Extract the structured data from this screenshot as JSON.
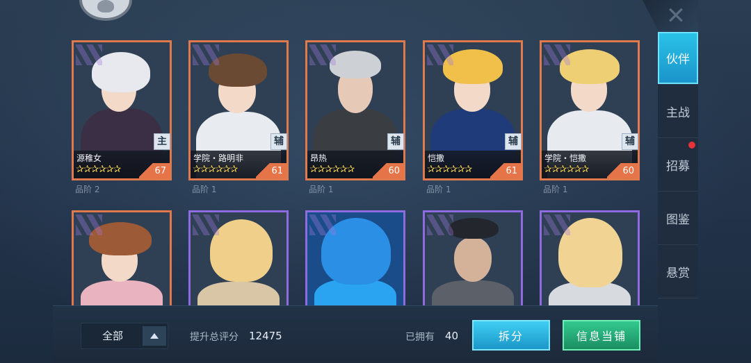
{
  "tabs": [
    {
      "label": "伙伴",
      "active": true,
      "notify": false
    },
    {
      "label": "主战",
      "active": false,
      "notify": false
    },
    {
      "label": "招募",
      "active": false,
      "notify": true
    },
    {
      "label": "图鉴",
      "active": false,
      "notify": false
    },
    {
      "label": "悬赏",
      "active": false,
      "notify": false
    }
  ],
  "cards_row1": [
    {
      "name": "源稚女",
      "stars": "✰✰✰✰✰✰",
      "level": "67",
      "role": "主",
      "grade": "品阶  2"
    },
    {
      "name": "学院・路明非",
      "stars": "✰✰✰✰✰✰",
      "level": "61",
      "role": "辅",
      "grade": "品阶  1"
    },
    {
      "name": "昂热",
      "stars": "✰✰✰✰✰✰",
      "level": "60",
      "role": "辅",
      "grade": "品阶  1"
    },
    {
      "name": "恺撒",
      "stars": "✰✰✰✰✰✰",
      "level": "61",
      "role": "辅",
      "grade": "品阶  1"
    },
    {
      "name": "学院・恺撒",
      "stars": "✰✰✰✰✰✰",
      "level": "60",
      "role": "辅",
      "grade": "品阶  1"
    }
  ],
  "filter": {
    "label": "全部"
  },
  "stats": {
    "score_label": "提升总评分",
    "score_value": "12475",
    "owned_label": "已拥有",
    "owned_value": "40"
  },
  "buttons": {
    "split": "拆分",
    "shop": "信息当铺"
  },
  "colors": {
    "orange_frame": "#e07a4d",
    "purple_frame": "#8e6be0",
    "accent": "#2ac3e8"
  }
}
